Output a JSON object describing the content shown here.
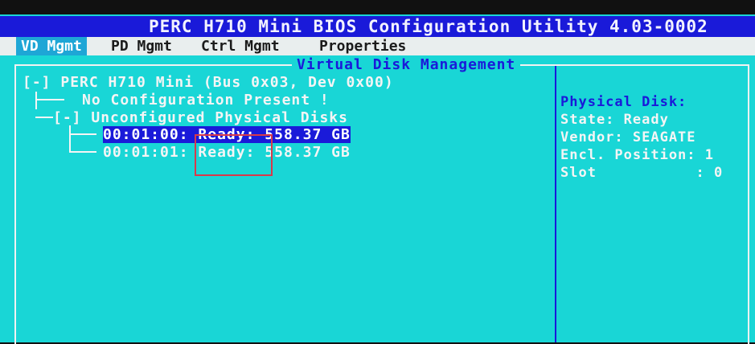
{
  "window": {
    "title": "PERC H710 Mini BIOS Configuration Utility 4.03-0002"
  },
  "menu": {
    "tabs": [
      {
        "label": "VD Mgmt",
        "active": true
      },
      {
        "label": "PD Mgmt",
        "active": false
      },
      {
        "label": "Ctrl Mgmt",
        "active": false
      },
      {
        "label": "Properties",
        "active": false
      }
    ]
  },
  "panel": {
    "title": "Virtual Disk Management"
  },
  "tree": {
    "controller": {
      "toggle": "[-]",
      "label": "PERC H710 Mini (Bus 0x03, Dev 0x00)"
    },
    "no_config": "No Configuration Present !",
    "unconfigured": {
      "toggle": "[-]",
      "label": "Unconfigured Physical Disks"
    },
    "disks": [
      {
        "id": "00:01:00:",
        "state": "Ready:",
        "size": "558.37 GB",
        "selected": true
      },
      {
        "id": "00:01:01:",
        "state": "Ready:",
        "size": "558.37 GB",
        "selected": false
      }
    ]
  },
  "details": {
    "header": "Physical Disk:",
    "state": "State: Ready",
    "vendor": "Vendor: SEAGATE",
    "encl_position": "Encl. Position: 1",
    "slot": "Slot           : 0"
  },
  "colors": {
    "background": "#19d6d6",
    "title_bar": "#1a1ad9",
    "annotation_box": "#d9394a"
  }
}
